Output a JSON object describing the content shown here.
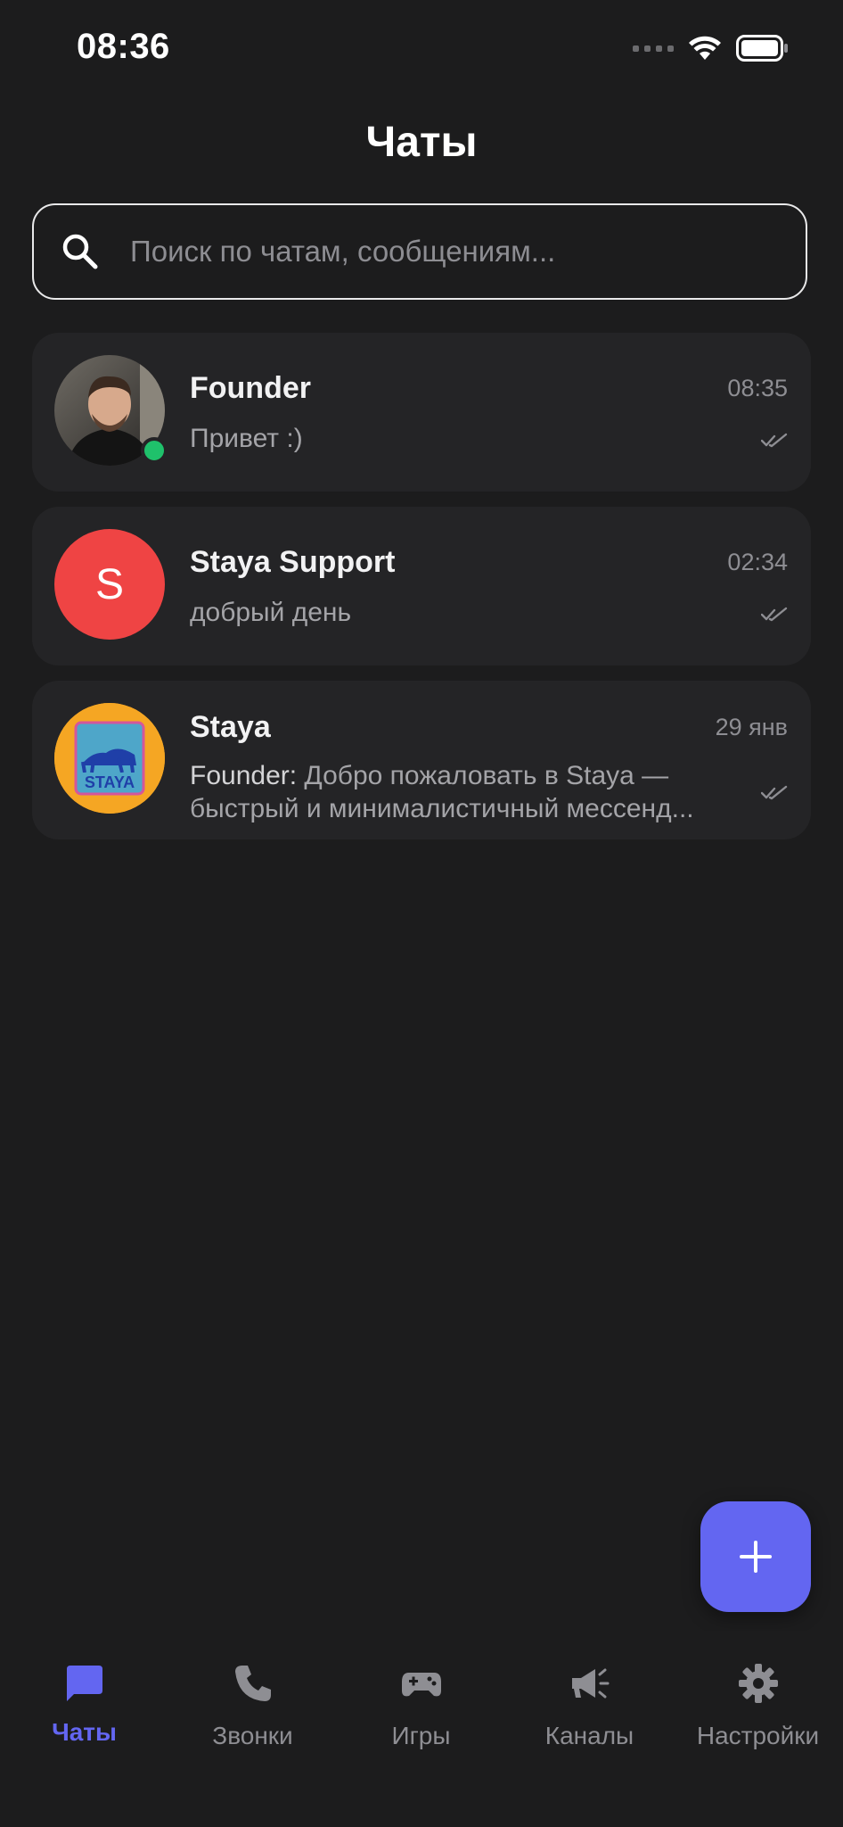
{
  "status_bar": {
    "time": "08:36"
  },
  "header": {
    "title": "Чаты"
  },
  "search": {
    "placeholder": "Поиск по чатам, сообщениям..."
  },
  "chats": [
    {
      "name": "Founder",
      "time": "08:35",
      "message": "Привет :)",
      "online": true,
      "avatar_type": "photo",
      "read_icon": "double-check-icon"
    },
    {
      "name": "Staya Support",
      "time": "02:34",
      "message": "добрый день",
      "avatar_letter": "S",
      "avatar_color": "#ef4444",
      "read_icon": "double-check-icon"
    },
    {
      "name": "Staya",
      "time": "29 янв",
      "sender": "Founder:",
      "message_line1": "Добро пожаловать в Staya —",
      "message_line2": "быстрый и минималистичный мессенд...",
      "avatar_logo_text": "STAYA",
      "avatar_color": "#f5a623",
      "read_icon": "double-check-icon"
    }
  ],
  "fab": {
    "icon": "plus-icon"
  },
  "nav": [
    {
      "label": "Чаты",
      "icon": "chat-bubble-icon",
      "active": true
    },
    {
      "label": "Звонки",
      "icon": "phone-icon"
    },
    {
      "label": "Игры",
      "icon": "gamepad-icon"
    },
    {
      "label": "Каналы",
      "icon": "megaphone-icon"
    },
    {
      "label": "Настройки",
      "icon": "gear-icon"
    }
  ],
  "colors": {
    "accent": "#6366f1",
    "background": "#1c1c1d",
    "card": "#242426",
    "online": "#1fc16b"
  }
}
